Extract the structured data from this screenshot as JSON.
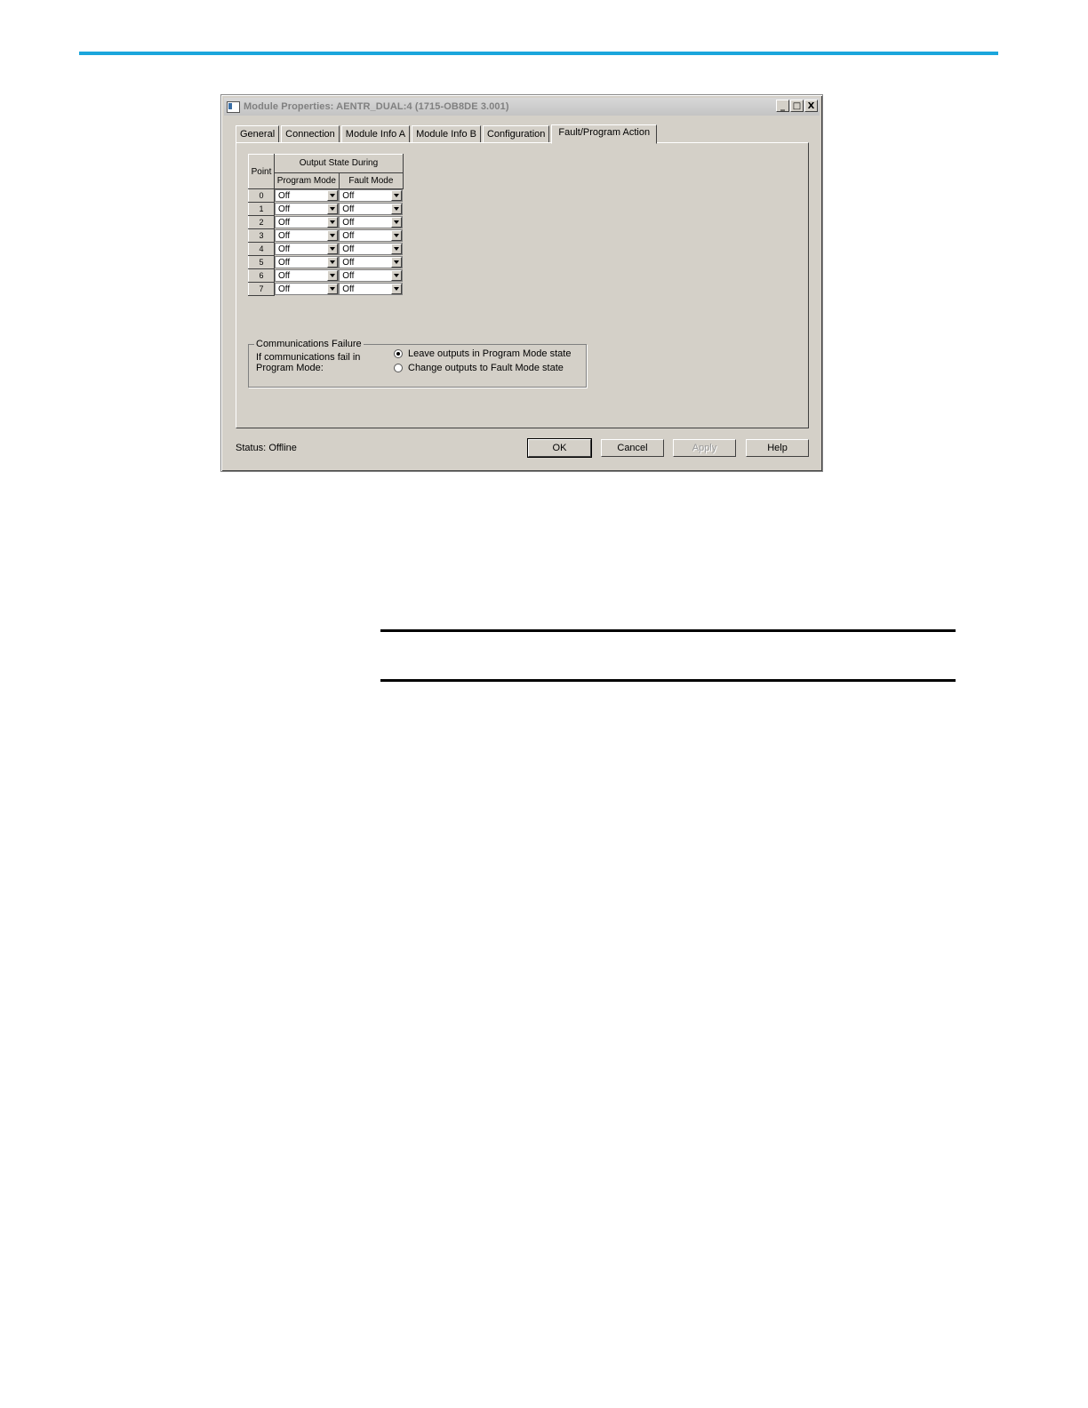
{
  "dialog": {
    "title": "Module Properties: AENTR_DUAL:4 (1715-OB8DE 3.001)",
    "window_buttons": [
      "_",
      "□",
      "X"
    ]
  },
  "tabs": [
    "General",
    "Connection",
    "Module Info A",
    "Module Info B",
    "Configuration",
    "Fault/Program Action"
  ],
  "active_tab": "Fault/Program Action",
  "table": {
    "point_header": "Point",
    "group_header": "Output State During",
    "col_program": "Program Mode",
    "col_fault": "Fault Mode",
    "rows": [
      {
        "point": "0",
        "program": "Off",
        "fault": "Off"
      },
      {
        "point": "1",
        "program": "Off",
        "fault": "Off"
      },
      {
        "point": "2",
        "program": "Off",
        "fault": "Off"
      },
      {
        "point": "3",
        "program": "Off",
        "fault": "Off"
      },
      {
        "point": "4",
        "program": "Off",
        "fault": "Off"
      },
      {
        "point": "5",
        "program": "Off",
        "fault": "Off"
      },
      {
        "point": "6",
        "program": "Off",
        "fault": "Off"
      },
      {
        "point": "7",
        "program": "Off",
        "fault": "Off"
      }
    ]
  },
  "comm_failure": {
    "legend": "Communications Failure",
    "description": "If communications fail in Program Mode:",
    "option_leave": "Leave outputs in Program Mode state",
    "option_change": "Change outputs to Fault Mode state",
    "selected": "leave"
  },
  "status": {
    "label": "Status:",
    "value": "Offline"
  },
  "buttons": {
    "ok": "OK",
    "cancel": "Cancel",
    "apply": "Apply",
    "help": "Help"
  },
  "colors": {
    "top_rule": "#1ba6dc",
    "dialog_bg": "#d4d0c8"
  }
}
